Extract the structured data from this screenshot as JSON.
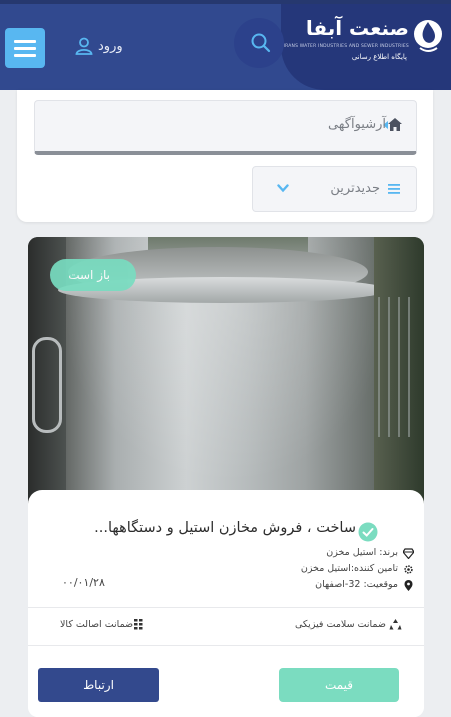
{
  "header": {
    "logo_title": "صنعت آبفا",
    "logo_subtitle_en": "IRANS WATER INDUSTRIES AND SEWER INDUSTRIES",
    "logo_subtitle_fa": "پایگاه اطلاع رسانی",
    "login_label": "ورود",
    "colors": {
      "header_bg": "#31498f",
      "logo_panel": "#25377a",
      "menu_button": "#58b7f1"
    }
  },
  "filters": {
    "breadcrumb": "آرشیوآگهی",
    "sort_label": "جدیدترین"
  },
  "listing": {
    "status_badge": "باز است",
    "title": "ساخت ، فروش مخازن استیل و دستگاهها...",
    "brand": "برند: استیل مخزن",
    "supplier": "تامین کننده:استیل مخزن",
    "location": "موقعیت: 32-اصفهان",
    "date": "۰۰/۰۱/۲۸",
    "guarantee_health": "ضمانت سلامت فیزیکی",
    "guarantee_authenticity": "ضمانت اصالت کالا",
    "price_button": "قیمت",
    "contact_button": "ارتباط",
    "colors": {
      "badge": "#78dcc0",
      "price_button": "#7bdcc0",
      "contact_button": "#33498d"
    }
  }
}
